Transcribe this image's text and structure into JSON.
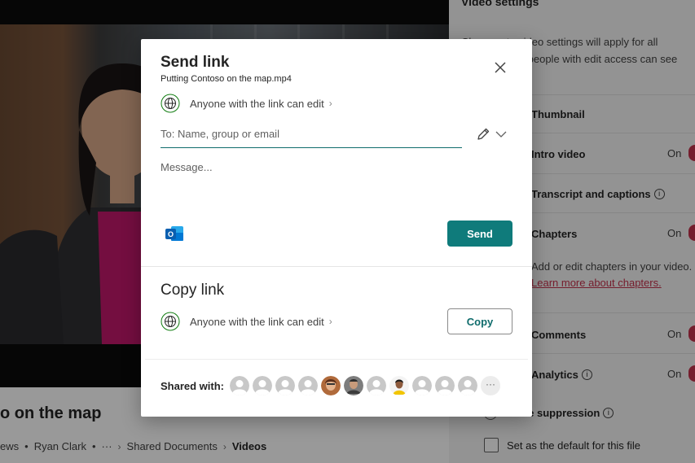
{
  "background": {
    "video_title": "o on the map",
    "crumbs": {
      "views": "ews",
      "author": "Ryan Clark",
      "ellipsis": "···",
      "folder": "Shared Documents",
      "current": "Videos"
    },
    "settings": {
      "title": "Video settings",
      "description": "Changes to video settings will apply for all viewers. Only people with edit access can see this panel.",
      "description_link": "L",
      "rows": [
        {
          "label": "Thumbnail",
          "state": ""
        },
        {
          "label": "Intro video",
          "state": "On"
        },
        {
          "label": "Transcript and captions",
          "state": ""
        },
        {
          "label": "Chapters",
          "state": "On"
        },
        {
          "label": "Comments",
          "state": "On"
        },
        {
          "label": "Analytics",
          "state": "On"
        }
      ],
      "chapters_desc": "Add or edit chapters in your video.",
      "chapters_link": "Learn more about chapters.",
      "noise_suppression": "Noise suppression",
      "default_checkbox": "Set as the default for this file"
    }
  },
  "dialog": {
    "title": "Send link",
    "filename": "Putting Contoso on the map.mp4",
    "permission_label": "Anyone with the link can edit",
    "to_placeholder": "To: Name, group or email",
    "message_placeholder": "Message...",
    "send_label": "Send",
    "copy_title": "Copy link",
    "copy_permission_label": "Anyone with the link can edit",
    "copy_label": "Copy",
    "shared_with_label": "Shared with:",
    "more_label": "···",
    "colors": {
      "accent": "#0f7b7b",
      "toggle_on": "#c4314b"
    }
  }
}
